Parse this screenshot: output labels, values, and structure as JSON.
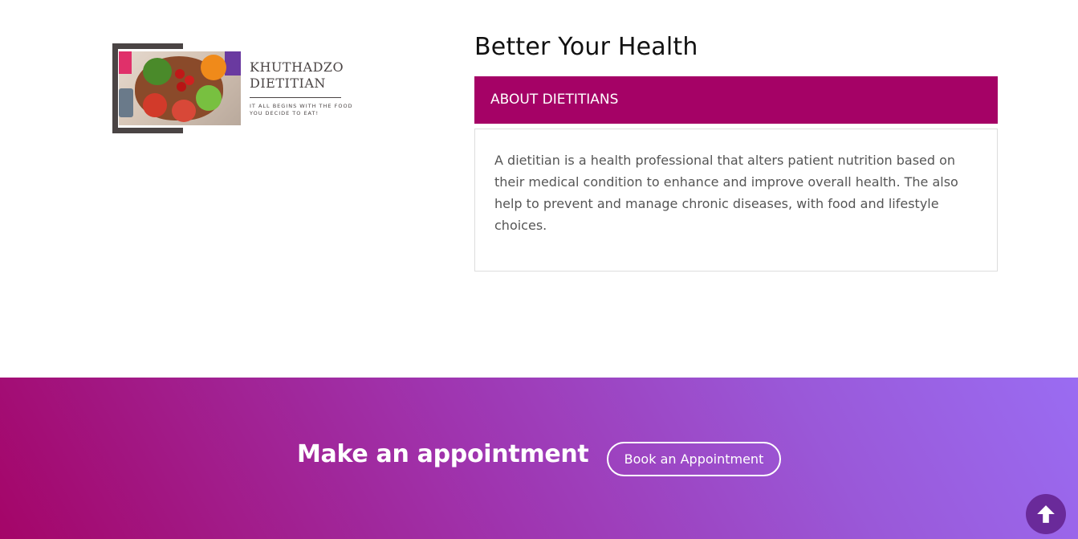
{
  "logo": {
    "title": "KHUTHADZO\nDIETITIAN",
    "tagline": "IT ALL BEGINS WITH THE FOOD YOU DECIDE TO EAT!"
  },
  "main": {
    "title": "Better Your Health",
    "accordion": {
      "header": "ABOUT DIETITIANS",
      "body": "A dietitian is a health professional that alters patient nutrition based on their medical condition to enhance and improve overall health. The also help to prevent and manage chronic diseases, with food and lifestyle choices."
    }
  },
  "cta": {
    "title": "Make an appointment",
    "button_label": "Book an Appointment"
  },
  "back_to_top": {
    "icon": "arrow-up-icon"
  },
  "colors": {
    "accent": "#a50266",
    "gradient_start": "#a40568",
    "gradient_end": "#9a6cf2",
    "back_to_top": "#6a2a9a"
  }
}
